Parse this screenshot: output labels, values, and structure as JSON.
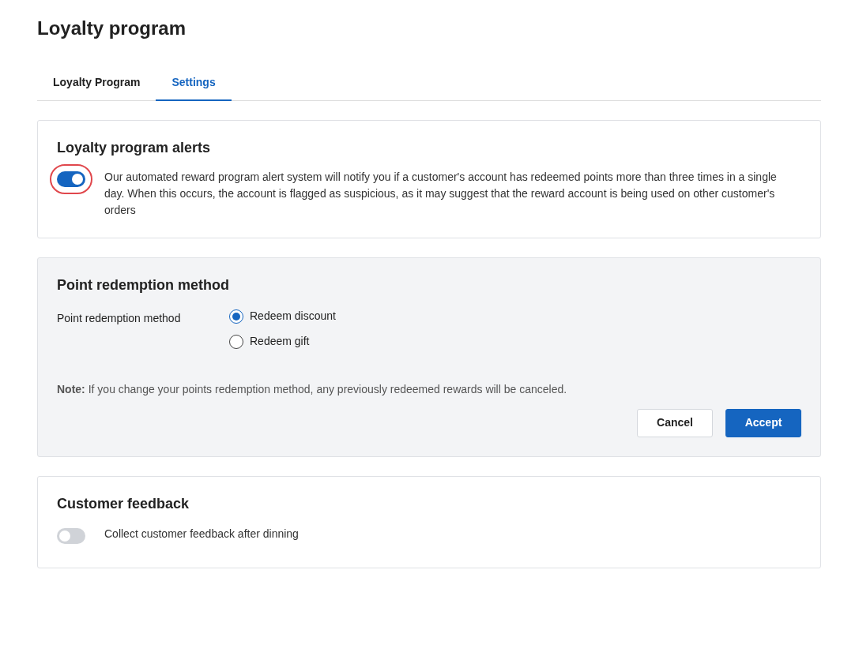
{
  "page_title": "Loyalty program",
  "tabs": [
    {
      "label": "Loyalty Program",
      "selected": false
    },
    {
      "label": "Settings",
      "selected": true
    }
  ],
  "sections": [
    {
      "kind": "toggle",
      "title": "Loyalty program alerts",
      "on": true,
      "highlighted": true,
      "text": "Our automated reward program alert system will notify you if a customer's account has redeemed points more than three times in a single day. When this occurs, the account is flagged as suspicious, as it may suggest that the reward account is being used on other customer's orders"
    },
    {
      "kind": "radio",
      "title": "Point redemption method",
      "field_label": "Point redemption method",
      "options": [
        {
          "label": "Redeem discount",
          "selected": true
        },
        {
          "label": "Redeem gift",
          "selected": false
        }
      ],
      "note": "**Note:** If you change your points redemption method, any previously redeemed rewards will be canceled.",
      "buttons": [
        {
          "label": "Cancel",
          "kind": "secondary"
        },
        {
          "label": "Accept",
          "kind": "primary"
        }
      ]
    },
    {
      "kind": "toggle",
      "title": "Customer feedback",
      "on": false,
      "highlighted": false,
      "text": "Collect customer feedback after dinning"
    }
  ]
}
